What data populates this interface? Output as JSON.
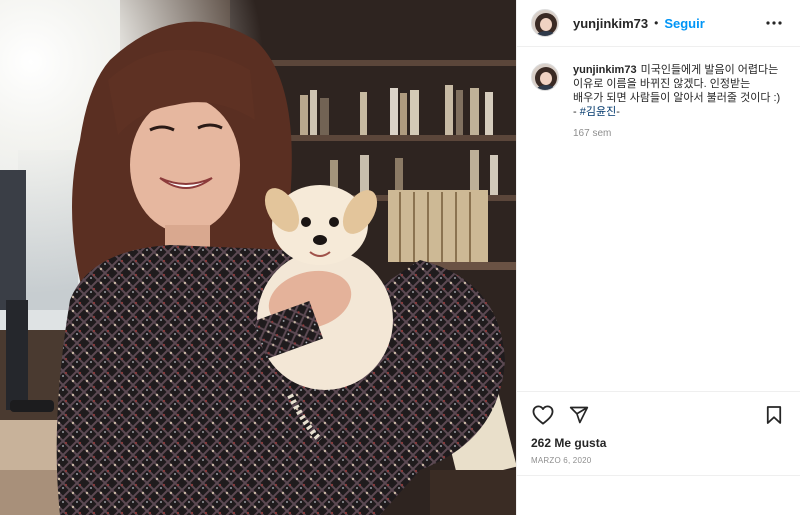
{
  "header": {
    "username": "yunjinkim73",
    "separator": "•",
    "follow_label": "Seguir",
    "more_icon": "more-horizontal-icon"
  },
  "caption": {
    "username": "yunjinkim73",
    "text": "미국인들에게 발음이 어렵다는 이유로 이름을 바뀌진 않겠다. 인정받는 배우가 되면 사람들이 알아서 불러줄 것이다 :) - ",
    "hashtag": "#김윤진",
    "trailing": "-",
    "time": "167 sem"
  },
  "actions": {
    "like_icon": "heart-icon",
    "share_icon": "send-icon",
    "save_icon": "bookmark-icon"
  },
  "likes": "262 Me gusta",
  "date": "MARZO 6, 2020",
  "colors": {
    "link": "#0095f6",
    "hashtag": "#00376b",
    "muted": "#8e8e8e",
    "text": "#262626",
    "divider": "#efefef"
  }
}
